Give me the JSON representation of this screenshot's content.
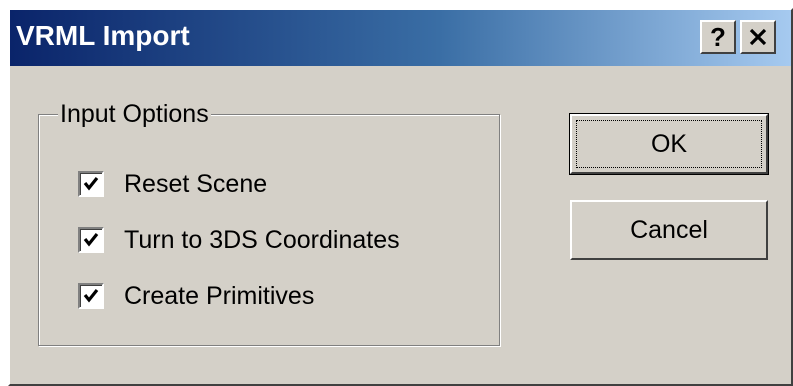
{
  "window": {
    "title": "VRML Import",
    "help_label": "?",
    "close_label": "✕"
  },
  "input_options": {
    "group_label": "Input Options",
    "checkboxes": [
      {
        "label": "Reset Scene",
        "checked": true
      },
      {
        "label": "Turn to 3DS Coordinates",
        "checked": true
      },
      {
        "label": "Create Primitives",
        "checked": true
      }
    ]
  },
  "buttons": {
    "ok_label": "OK",
    "cancel_label": "Cancel"
  },
  "colors": {
    "titlebar_start": "#0a246a",
    "titlebar_end": "#a6caf0",
    "dialog_face": "#d4d0c8"
  },
  "icons": {
    "check": "check-mark-icon",
    "help": "help-icon",
    "close": "close-icon"
  }
}
